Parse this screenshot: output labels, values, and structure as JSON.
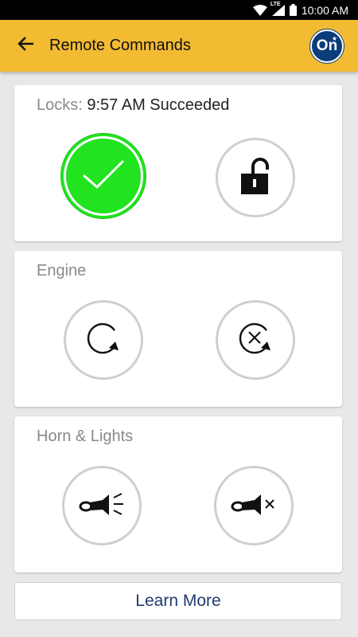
{
  "status_bar": {
    "time": "10:00 AM",
    "network": "LTE"
  },
  "app_bar": {
    "title": "Remote Commands",
    "back_icon": "arrow-left-icon",
    "logo_text": "On"
  },
  "cards": {
    "locks": {
      "label": "Locks:",
      "status": "9:57 AM Succeeded",
      "lock_button_icon": "checkmark-icon",
      "unlock_button_icon": "unlocked-padlock-icon"
    },
    "engine": {
      "label": "Engine",
      "start_icon": "remote-start-icon",
      "cancel_icon": "cancel-start-icon"
    },
    "horn_lights": {
      "label": "Horn & Lights",
      "on_icon": "horn-lights-on-icon",
      "off_icon": "horn-lights-off-icon"
    }
  },
  "learn_more": {
    "label": "Learn More"
  },
  "colors": {
    "app_bar": "#f2bb32",
    "success": "#22e31f",
    "link": "#1f3a73",
    "ring": "#cfcfcf"
  }
}
